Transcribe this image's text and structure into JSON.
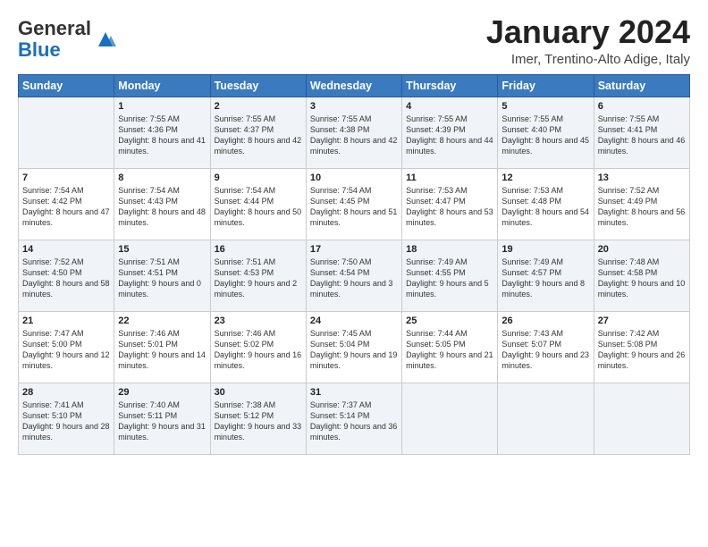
{
  "header": {
    "logo_line1": "General",
    "logo_line2": "Blue",
    "month": "January 2024",
    "location": "Imer, Trentino-Alto Adige, Italy"
  },
  "weekdays": [
    "Sunday",
    "Monday",
    "Tuesday",
    "Wednesday",
    "Thursday",
    "Friday",
    "Saturday"
  ],
  "weeks": [
    [
      {
        "day": "",
        "sunrise": "",
        "sunset": "",
        "daylight": ""
      },
      {
        "day": "1",
        "sunrise": "7:55 AM",
        "sunset": "4:36 PM",
        "daylight": "8 hours and 41 minutes."
      },
      {
        "day": "2",
        "sunrise": "7:55 AM",
        "sunset": "4:37 PM",
        "daylight": "8 hours and 42 minutes."
      },
      {
        "day": "3",
        "sunrise": "7:55 AM",
        "sunset": "4:38 PM",
        "daylight": "8 hours and 42 minutes."
      },
      {
        "day": "4",
        "sunrise": "7:55 AM",
        "sunset": "4:39 PM",
        "daylight": "8 hours and 44 minutes."
      },
      {
        "day": "5",
        "sunrise": "7:55 AM",
        "sunset": "4:40 PM",
        "daylight": "8 hours and 45 minutes."
      },
      {
        "day": "6",
        "sunrise": "7:55 AM",
        "sunset": "4:41 PM",
        "daylight": "8 hours and 46 minutes."
      }
    ],
    [
      {
        "day": "7",
        "sunrise": "7:54 AM",
        "sunset": "4:42 PM",
        "daylight": "8 hours and 47 minutes."
      },
      {
        "day": "8",
        "sunrise": "7:54 AM",
        "sunset": "4:43 PM",
        "daylight": "8 hours and 48 minutes."
      },
      {
        "day": "9",
        "sunrise": "7:54 AM",
        "sunset": "4:44 PM",
        "daylight": "8 hours and 50 minutes."
      },
      {
        "day": "10",
        "sunrise": "7:54 AM",
        "sunset": "4:45 PM",
        "daylight": "8 hours and 51 minutes."
      },
      {
        "day": "11",
        "sunrise": "7:53 AM",
        "sunset": "4:47 PM",
        "daylight": "8 hours and 53 minutes."
      },
      {
        "day": "12",
        "sunrise": "7:53 AM",
        "sunset": "4:48 PM",
        "daylight": "8 hours and 54 minutes."
      },
      {
        "day": "13",
        "sunrise": "7:52 AM",
        "sunset": "4:49 PM",
        "daylight": "8 hours and 56 minutes."
      }
    ],
    [
      {
        "day": "14",
        "sunrise": "7:52 AM",
        "sunset": "4:50 PM",
        "daylight": "8 hours and 58 minutes."
      },
      {
        "day": "15",
        "sunrise": "7:51 AM",
        "sunset": "4:51 PM",
        "daylight": "9 hours and 0 minutes."
      },
      {
        "day": "16",
        "sunrise": "7:51 AM",
        "sunset": "4:53 PM",
        "daylight": "9 hours and 2 minutes."
      },
      {
        "day": "17",
        "sunrise": "7:50 AM",
        "sunset": "4:54 PM",
        "daylight": "9 hours and 3 minutes."
      },
      {
        "day": "18",
        "sunrise": "7:49 AM",
        "sunset": "4:55 PM",
        "daylight": "9 hours and 5 minutes."
      },
      {
        "day": "19",
        "sunrise": "7:49 AM",
        "sunset": "4:57 PM",
        "daylight": "9 hours and 8 minutes."
      },
      {
        "day": "20",
        "sunrise": "7:48 AM",
        "sunset": "4:58 PM",
        "daylight": "9 hours and 10 minutes."
      }
    ],
    [
      {
        "day": "21",
        "sunrise": "7:47 AM",
        "sunset": "5:00 PM",
        "daylight": "9 hours and 12 minutes."
      },
      {
        "day": "22",
        "sunrise": "7:46 AM",
        "sunset": "5:01 PM",
        "daylight": "9 hours and 14 minutes."
      },
      {
        "day": "23",
        "sunrise": "7:46 AM",
        "sunset": "5:02 PM",
        "daylight": "9 hours and 16 minutes."
      },
      {
        "day": "24",
        "sunrise": "7:45 AM",
        "sunset": "5:04 PM",
        "daylight": "9 hours and 19 minutes."
      },
      {
        "day": "25",
        "sunrise": "7:44 AM",
        "sunset": "5:05 PM",
        "daylight": "9 hours and 21 minutes."
      },
      {
        "day": "26",
        "sunrise": "7:43 AM",
        "sunset": "5:07 PM",
        "daylight": "9 hours and 23 minutes."
      },
      {
        "day": "27",
        "sunrise": "7:42 AM",
        "sunset": "5:08 PM",
        "daylight": "9 hours and 26 minutes."
      }
    ],
    [
      {
        "day": "28",
        "sunrise": "7:41 AM",
        "sunset": "5:10 PM",
        "daylight": "9 hours and 28 minutes."
      },
      {
        "day": "29",
        "sunrise": "7:40 AM",
        "sunset": "5:11 PM",
        "daylight": "9 hours and 31 minutes."
      },
      {
        "day": "30",
        "sunrise": "7:38 AM",
        "sunset": "5:12 PM",
        "daylight": "9 hours and 33 minutes."
      },
      {
        "day": "31",
        "sunrise": "7:37 AM",
        "sunset": "5:14 PM",
        "daylight": "9 hours and 36 minutes."
      },
      {
        "day": "",
        "sunrise": "",
        "sunset": "",
        "daylight": ""
      },
      {
        "day": "",
        "sunrise": "",
        "sunset": "",
        "daylight": ""
      },
      {
        "day": "",
        "sunrise": "",
        "sunset": "",
        "daylight": ""
      }
    ]
  ]
}
